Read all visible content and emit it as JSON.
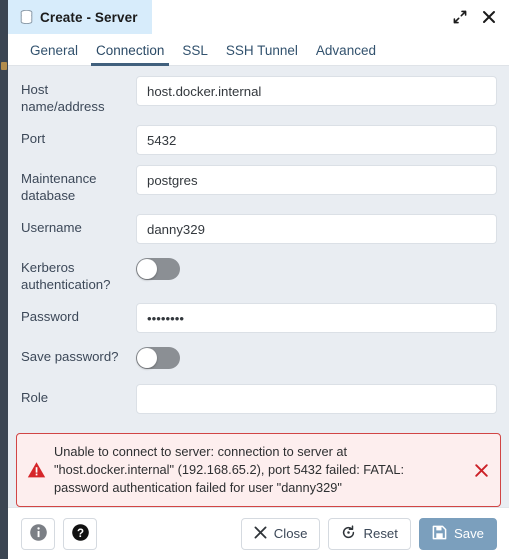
{
  "window": {
    "tab_title": "Create - Server",
    "tab_icon": "database-icon",
    "expand_icon": "expand-icon",
    "close_icon": "close-icon"
  },
  "tabs": [
    {
      "label": "General",
      "active": false
    },
    {
      "label": "Connection",
      "active": true
    },
    {
      "label": "SSL",
      "active": false
    },
    {
      "label": "SSH Tunnel",
      "active": false
    },
    {
      "label": "Advanced",
      "active": false
    }
  ],
  "fields": {
    "host": {
      "label": "Host name/address",
      "value": "host.docker.internal"
    },
    "port": {
      "label": "Port",
      "value": "5432"
    },
    "maintenance_db": {
      "label": "Maintenance database",
      "value": "postgres"
    },
    "username": {
      "label": "Username",
      "value": "danny329"
    },
    "kerberos": {
      "label": "Kerberos authentication?",
      "state": "off"
    },
    "password": {
      "label": "Password",
      "value": "••••••••"
    },
    "save_password": {
      "label": "Save password?",
      "state": "off"
    },
    "role": {
      "label": "Role",
      "value": ""
    }
  },
  "error": {
    "icon": "warning-triangle-icon",
    "line1": "Unable to connect to server: connection to server at",
    "line2": "\"host.docker.internal\" (192.168.65.2), port 5432 failed: FATAL:",
    "line3": "password authentication failed for user \"danny329\"",
    "close_icon": "close-icon",
    "border_color": "#d14545",
    "background_color": "#fdeeee"
  },
  "footer": {
    "info_label": "i",
    "help_label": "?",
    "close_label": "Close",
    "reset_label": "Reset",
    "save_label": "Save",
    "save_color": "#7b9fbd"
  }
}
